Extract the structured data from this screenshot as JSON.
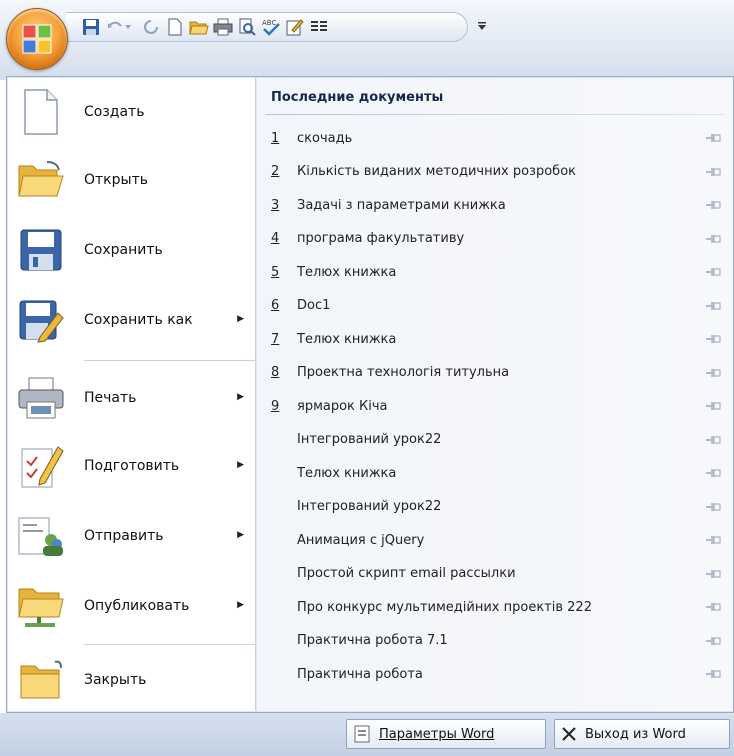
{
  "left_menu": {
    "items": [
      {
        "label": "Создать",
        "icon": "new-document-icon",
        "submenu": false
      },
      {
        "label": "Открыть",
        "icon": "open-folder-icon",
        "submenu": false
      },
      {
        "label": "Сохранить",
        "icon": "save-disk-icon",
        "submenu": false
      },
      {
        "label": "Сохранить как",
        "icon": "save-as-icon",
        "submenu": true
      },
      {
        "label": "Печать",
        "icon": "printer-icon",
        "submenu": true
      },
      {
        "label": "Подготовить",
        "icon": "prepare-document-icon",
        "submenu": true
      },
      {
        "label": "Отправить",
        "icon": "send-icon",
        "submenu": true
      },
      {
        "label": "Опубликовать",
        "icon": "publish-folder-icon",
        "submenu": true
      },
      {
        "label": "Закрыть",
        "icon": "close-folder-icon",
        "submenu": false
      }
    ]
  },
  "recent": {
    "title": "Последние документы",
    "items": [
      {
        "num": "1",
        "name": "скочадь"
      },
      {
        "num": "2",
        "name": "Кількість виданих методичних розробок"
      },
      {
        "num": "3",
        "name": "Задачі з параметрами книжка"
      },
      {
        "num": "4",
        "name": "програма факультативу"
      },
      {
        "num": "5",
        "name": "Телюх книжка"
      },
      {
        "num": "6",
        "name": "Doc1"
      },
      {
        "num": "7",
        "name": "Телюх книжка"
      },
      {
        "num": "8",
        "name": "Проектна технологія титульна"
      },
      {
        "num": "9",
        "name": "ярмарок Кіча"
      },
      {
        "num": "",
        "name": "Інтегрований урок22"
      },
      {
        "num": "",
        "name": "Телюх книжка"
      },
      {
        "num": "",
        "name": "Інтегрований урок22"
      },
      {
        "num": "",
        "name": "Анимация с jQuery"
      },
      {
        "num": "",
        "name": "Простой скрипт email рассылки"
      },
      {
        "num": "",
        "name": "Про конкурс мультимедійних проектів 222"
      },
      {
        "num": "",
        "name": "Практична робота 7.1"
      },
      {
        "num": "",
        "name": "Практична робота"
      }
    ]
  },
  "bottom": {
    "options_label": "Параметры Word",
    "exit_label": "Выход из Word"
  },
  "quick_access": [
    "save-icon",
    "undo-icon",
    "redo-icon",
    "new-icon",
    "open-icon",
    "print-icon",
    "print-preview-icon",
    "spelling-icon",
    "edit-icon",
    "columns-icon"
  ],
  "colors": {
    "accent": "#d06b0e",
    "panel": "#dde6f1",
    "text": "#15284b"
  }
}
